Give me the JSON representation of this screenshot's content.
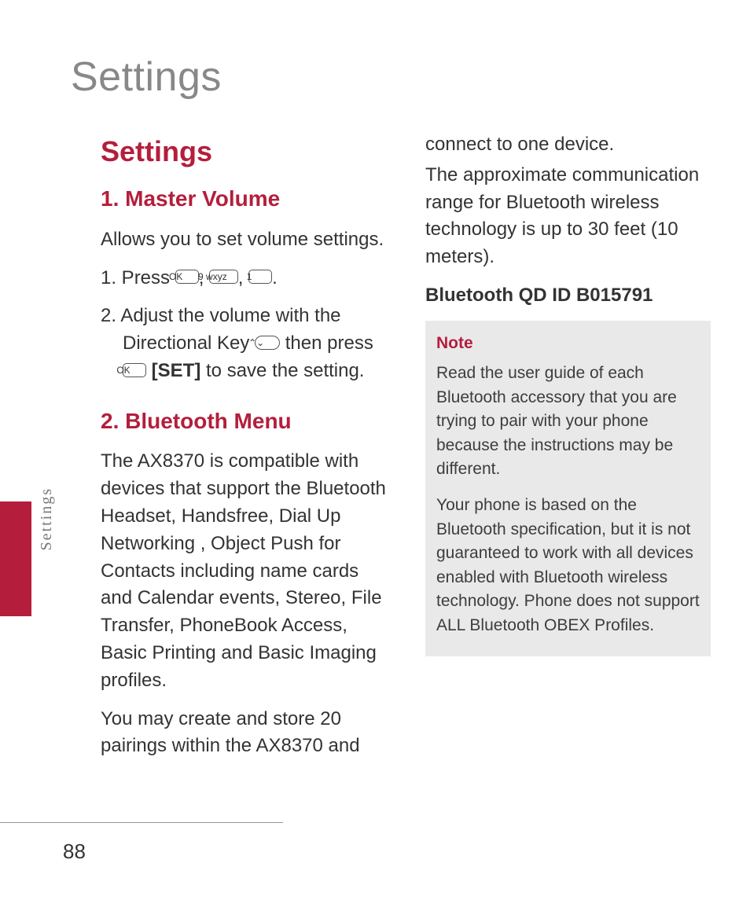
{
  "page": {
    "title": "Settings",
    "sideLabel": "Settings",
    "number": "88"
  },
  "col": {
    "h1": "Settings",
    "s1_title": "1. Master Volume",
    "s1_intro": "Allows you to set volume settings.",
    "s1_step1_a": "1. Press ",
    "keys": {
      "ok": "OK",
      "nine": "9 wxyz",
      "one": "1",
      "dir": "⌃⌄"
    },
    "s1_step1_comma": ", ",
    "s1_step1_end": ".",
    "s1_step2_a": "2. Adjust the volume with the Directional Key ",
    "s1_step2_b": " then press ",
    "s1_step2_set": "[SET]",
    "s1_step2_c": " to save the setting.",
    "s2_title": "2. Bluetooth Menu",
    "s2_p1": "The AX8370 is compatible with devices that support the Bluetooth Headset, Handsfree, Dial Up Networking , Object Push for Contacts including name cards and Calendar events, Stereo, File Transfer, PhoneBook Access, Basic Printing and Basic Imaging profiles.",
    "s2_p2": "You may create and store 20 pairings within the AX8370 and connect to one device.",
    "s2_p3": "The approximate communication range for Bluetooth wireless technology is up to 30 feet (10 meters).",
    "s2_qd": "Bluetooth QD ID B015791",
    "note_title": "Note",
    "note_p1": "Read the user guide of each Bluetooth accessory that you are trying to pair with your phone because the instructions may be different.",
    "note_p2": "Your phone is based on the Bluetooth specification, but it is not guaranteed to work with all devices enabled with Bluetooth wireless technology. Phone does not support ALL Bluetooth OBEX Profiles."
  }
}
